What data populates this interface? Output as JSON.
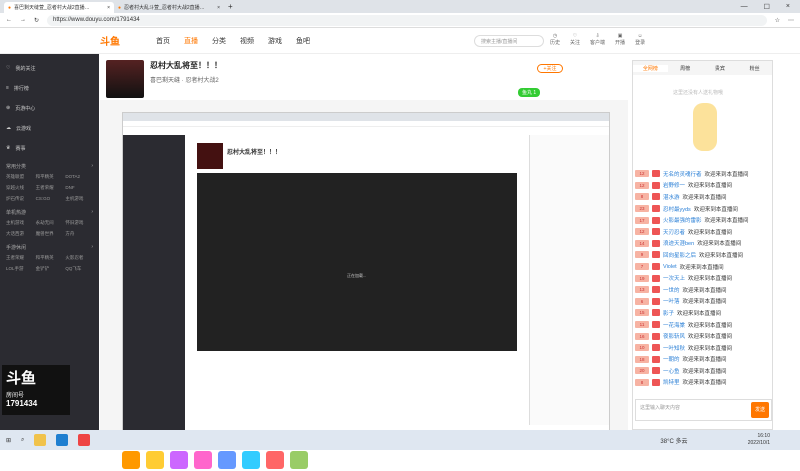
{
  "browser": {
    "tabs": [
      {
        "label": "喜巴剩天缝萱_忍者村大战2直播…"
      },
      {
        "label": "忍者村大乱斗萱_忍者村大战2直播…"
      }
    ],
    "url": "https://www.douyu.com/1791434"
  },
  "header": {
    "logo": "斗鱼",
    "nav": [
      "首页",
      "直播",
      "分类",
      "视频",
      "游戏",
      "鱼吧"
    ],
    "search_placeholder": "搜索主播/直播间",
    "icons": [
      "历史",
      "关注",
      "客户端",
      "开播",
      "登录"
    ]
  },
  "sidebar": {
    "items": [
      "我的关注",
      "排行榜",
      "页游中心",
      "云游戏",
      "赛事"
    ],
    "sections": [
      {
        "title": "常用分类",
        "games": [
          "英雄联盟",
          "和平精英",
          "DOTA2",
          "穿越火线",
          "王者荣耀",
          "DNF",
          "炉石传说",
          "CS:GO",
          "主机游戏"
        ]
      },
      {
        "title": "单机热游",
        "games": [
          "主机游戏",
          "永劫无间",
          "怀旧游戏",
          "大话西游",
          "魔兽世界",
          "方舟"
        ]
      },
      {
        "title": "手游休闲",
        "games": [
          "王者荣耀",
          "和平精英",
          "火影忍者",
          "LOL手游",
          "金铲铲",
          "QQ飞车"
        ]
      }
    ],
    "room_label": "房间号",
    "room_number": "1791434"
  },
  "anchor": {
    "title": "忍村大乱将至！！！",
    "name": "喜巴剩天缝",
    "category": "忍者村大战2",
    "follow_label": "+关注",
    "score_label": "鱼丸 1"
  },
  "inner_video": {
    "title": "忍村大乱将至！！！",
    "loading_text": "正在加载..."
  },
  "right_panel": {
    "tabs": [
      "全网榜",
      "周榜",
      "贵宾",
      "粉丝"
    ],
    "mascot_text": "这里还没有人送礼物哦"
  },
  "chat": {
    "messages": [
      {
        "level": "12",
        "user": "无名的灵魂行者",
        "text": "欢迎来到本直播间"
      },
      {
        "level": "12",
        "user": "岩野修一",
        "text": "欢迎来到本直播间"
      },
      {
        "level": "8",
        "user": "湛水游",
        "text": "欢迎来到本直播间"
      },
      {
        "level": "23",
        "user": "忍村最yyds",
        "text": "欢迎来到本直播间"
      },
      {
        "level": "17",
        "user": "火影最强的雷影",
        "text": "欢迎来到本直播间"
      },
      {
        "level": "12",
        "user": "天刃忍者",
        "text": "欢迎来到本直播间"
      },
      {
        "level": "14",
        "user": "浪迹天涯ben",
        "text": "欢迎来到本直播间"
      },
      {
        "level": "9",
        "user": "回向星影之后",
        "text": "欢迎来到本直播间"
      },
      {
        "level": "7",
        "user": "Violet",
        "text": "欢迎来到本直播间"
      },
      {
        "level": "19",
        "user": "一次天上",
        "text": "欢迎来到本直播间"
      },
      {
        "level": "13",
        "user": "一世的",
        "text": "欢迎来到本直播间"
      },
      {
        "level": "6",
        "user": "一叶落",
        "text": "欢迎来到本直播间"
      },
      {
        "level": "15",
        "user": "影子",
        "text": "欢迎来到本直播间"
      },
      {
        "level": "11",
        "user": "一花海棠",
        "text": "欢迎来到本直播间"
      },
      {
        "level": "16",
        "user": "夜影斩风",
        "text": "欢迎来到本直播间"
      },
      {
        "level": "10",
        "user": "一叶知秋",
        "text": "欢迎来到本直播间"
      },
      {
        "level": "18",
        "user": "一朝的",
        "text": "欢迎来到本直播间"
      },
      {
        "level": "20",
        "user": "一心鱼",
        "text": "欢迎来到本直播间"
      },
      {
        "level": "8",
        "user": "凯特里",
        "text": "欢迎来到本直播间"
      }
    ],
    "input_placeholder": "这里输入聊天内容",
    "send_label": "发送"
  },
  "taskbar": {
    "weather": "38°C 多云",
    "time": "16:10",
    "date": "2022/10/1"
  }
}
